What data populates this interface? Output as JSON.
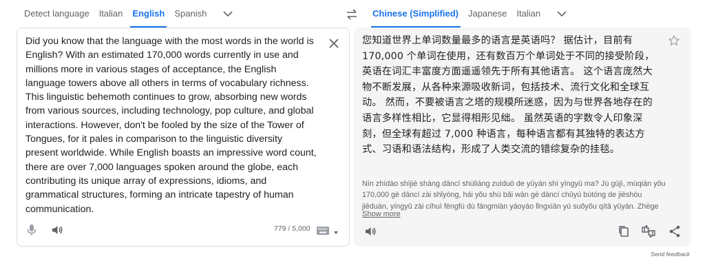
{
  "source_languages": {
    "tabs": [
      "Detect language",
      "Italian",
      "English",
      "Spanish"
    ],
    "active": "English"
  },
  "target_languages": {
    "tabs": [
      "Chinese (Simplified)",
      "Japanese",
      "Italian"
    ],
    "active": "Chinese (Simplified)"
  },
  "source": {
    "text": "Did you know that the language with the most words in the world is English? With an estimated 170,000 words currently in use and millions more in various stages of acceptance, the English language towers above all others in terms of vocabulary richness. This linguistic behemoth continues to grow, absorbing new words from various sources, including technology, pop culture, and global interactions. However, don't be fooled by the size of the Tower of Tongues, for it pales in comparison to the linguistic diversity present worldwide. While English boasts an impressive word count, there are over 7,000 languages spoken around the globe, each contributing its unique array of expressions, idioms, and grammatical structures, forming an intricate tapestry of human communication.",
    "char_count": "779 / 5,000"
  },
  "target": {
    "text": "您知道世界上单词数量最多的语言是英语吗？ 据估计，目前有 170,000 个单词在使用，还有数百万个单词处于不同的接受阶段，英语在词汇丰富度方面遥遥领先于所有其他语言。 这个语言庞然大物不断发展，从各种来源吸收新词，包括技术、流行文化和全球互动。 然而，不要被语言之塔的规模所迷惑，因为与世界各地存在的语言多样性相比，它显得相形见绌。 虽然英语的字数令人印象深刻，但全球有超过 7,000 种语言，每种语言都有其独特的表达方式、习语和语法结构，形成了人类交流的错综复杂的挂毯。",
    "transliteration": "Nín zhīdào shìjiè shàng dāncí shùliàng zuìduō de yǔyán shì yīngyǔ ma? Jù gūjì, mùqián yǒu 170,000 gè dāncí zài shǐyòng, hái yǒu shù bǎi wàn gè dāncí chǔyú bùtóng de jiēshòu jiēduàn, yīngyǔ zài cíhuì fēngfù dù fāngmiàn yáoyáo lǐngxiān yú suǒyǒu qítā yǔyán. Zhège",
    "show_more": "Show more"
  },
  "footer": {
    "send_feedback": "Send feedback"
  },
  "icons": {
    "swap": "swap-languages-icon",
    "clear": "close-icon",
    "mic": "microphone-icon",
    "speaker": "speaker-icon",
    "keyboard": "keyboard-icon",
    "star": "star-icon",
    "copy": "copy-icon",
    "rate": "rate-translation-icon",
    "share": "share-icon"
  },
  "colors": {
    "accent": "#1a73e8",
    "target_panel_bg": "#f5f5f5",
    "border": "#dadce0"
  }
}
